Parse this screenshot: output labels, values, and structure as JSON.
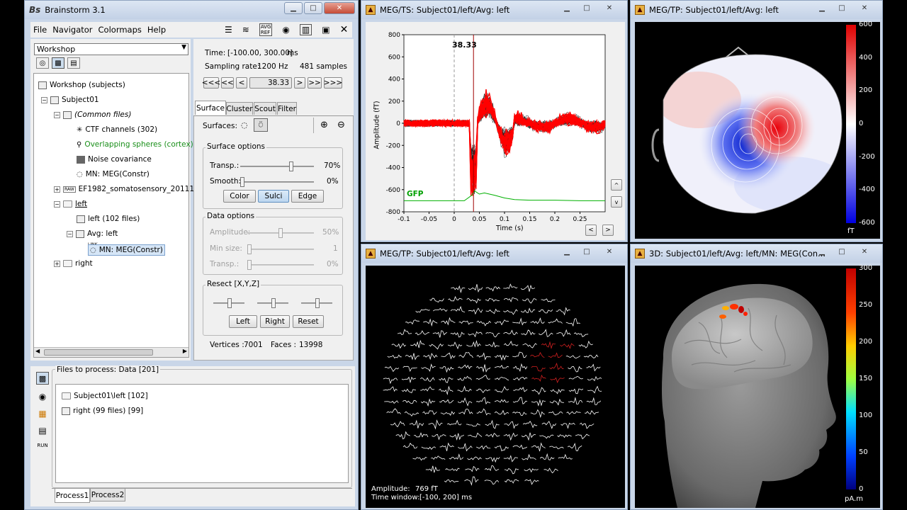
{
  "main_window": {
    "title": "Brainstorm 3.1",
    "menu": [
      "File",
      "Navigator",
      "Colormaps",
      "Help"
    ],
    "toolbar_icons": [
      "avg-ref-icon",
      "layout-icon"
    ],
    "protocol": "Workshop",
    "tree": {
      "root": "Workshop (subjects)",
      "subject": "Subject01",
      "common_files": "(Common files)",
      "ctf_channels": "CTF channels (302)",
      "headmodel": "Overlapping spheres (cortex)",
      "noise_cov": "Noise covariance",
      "mn_common": "MN: MEG(Constr)",
      "raw_label": "RAW",
      "raw_file": "EF1982_somatosensory_2011110",
      "left": "left",
      "left_files": "left (102 files)",
      "avg_left": "Avg: left",
      "link_label": "LINK",
      "mn_link": "MN: MEG(Constr)",
      "right": "right"
    },
    "time_panel": {
      "time_label": "Time:",
      "time_value": "[-100.00, 300.00]",
      "time_unit": "ms",
      "sampling_label": "Sampling rate:",
      "sampling_value": "1200 Hz",
      "samples": "481 samples",
      "nav_buttons": [
        "<<<",
        "<<",
        "<",
        "38.33",
        ">",
        ">>",
        ">>>"
      ]
    },
    "tabs": [
      "Surface",
      "Cluster",
      "Scout",
      "Filter"
    ],
    "surfaces_label": "Surfaces:",
    "surface_options": {
      "title": "Surface options",
      "transp_label": "Transp.:",
      "transp_value": "70%",
      "transp_fraction": 0.7,
      "smooth_label": "Smooth:",
      "smooth_value": "0%",
      "smooth_fraction": 0.0,
      "buttons": [
        "Color",
        "Sulci",
        "Edge"
      ]
    },
    "data_options": {
      "title": "Data options",
      "amplitude_label": "Amplitude:",
      "amplitude_value": "50%",
      "amplitude_fraction": 0.5,
      "minsize_label": "Min size:",
      "minsize_value": "1",
      "transp_label": "Transp.:",
      "transp_value": "0%"
    },
    "resect": {
      "title": "Resect [X,Y,Z]",
      "buttons": [
        "Left",
        "Right",
        "Reset"
      ]
    },
    "vertices_label": "Vertices :",
    "vertices_value": "7001",
    "faces_label": "Faces :",
    "faces_value": "13998",
    "files_to_process": {
      "title": "Files to process: Data [201]",
      "items": [
        "Subject01\\left [102]",
        "right (99 files) [99]"
      ],
      "side_label": "RUN",
      "tabs": [
        "Process1",
        "Process2"
      ]
    }
  },
  "ts_window": {
    "title": "MEG/TS: Subject01/left/Avg: left",
    "cursor_label": "38.33",
    "gfp_label": "GFP",
    "ylabel": "Amplitude (fT)",
    "xlabel": "Time (s)",
    "yticks": [
      "800",
      "600",
      "400",
      "200",
      "0",
      "-200",
      "-400",
      "-600",
      "-800"
    ],
    "xticks": [
      "-0.1",
      "-0.05",
      "0",
      "0.05",
      "0.1",
      "0.15",
      "0.2",
      "0.25"
    ],
    "side_buttons": [
      "^",
      "v"
    ],
    "nav_buttons": [
      "<",
      ">"
    ]
  },
  "tp_window": {
    "title": "MEG/TP: Subject01/left/Avg: left",
    "colorbar_ticks": [
      "600",
      "400",
      "200",
      "0",
      "-200",
      "-400",
      "-600"
    ],
    "unit": "fT"
  },
  "tp2_window": {
    "title": "MEG/TP: Subject01/left/Avg: left",
    "amplitude_label": "Amplitude:",
    "amplitude_value": "769 fT",
    "time_window_label": "Time window:",
    "time_window_value": "[-100, 200] ms"
  },
  "threed_window": {
    "title": "3D: Subject01/left/Avg: left/MN: MEG(Con...",
    "colorbar_ticks": [
      "300",
      "250",
      "200",
      "150",
      "100",
      "50",
      "0"
    ],
    "unit": "pA.m"
  },
  "chart_data": [
    {
      "type": "line",
      "title": "",
      "xlabel": "Time (s)",
      "ylabel": "Amplitude (fT)",
      "xlim": [
        -0.1,
        0.3
      ],
      "ylim": [
        -800,
        800
      ],
      "series": [
        {
          "name": "GFP",
          "x": [
            -0.1,
            -0.05,
            0,
            0.02,
            0.035,
            0.04,
            0.05,
            0.06,
            0.08,
            0.1,
            0.12,
            0.15,
            0.2,
            0.25,
            0.3
          ],
          "values": [
            -700,
            -700,
            -700,
            -700,
            -650,
            -610,
            -640,
            -630,
            -650,
            -675,
            -690,
            -695,
            -695,
            -700,
            -700
          ]
        }
      ],
      "cursor": 0.03833,
      "color_gfp": "#00b000",
      "color_selected": "#ff0000",
      "color_others": "#202020"
    }
  ]
}
